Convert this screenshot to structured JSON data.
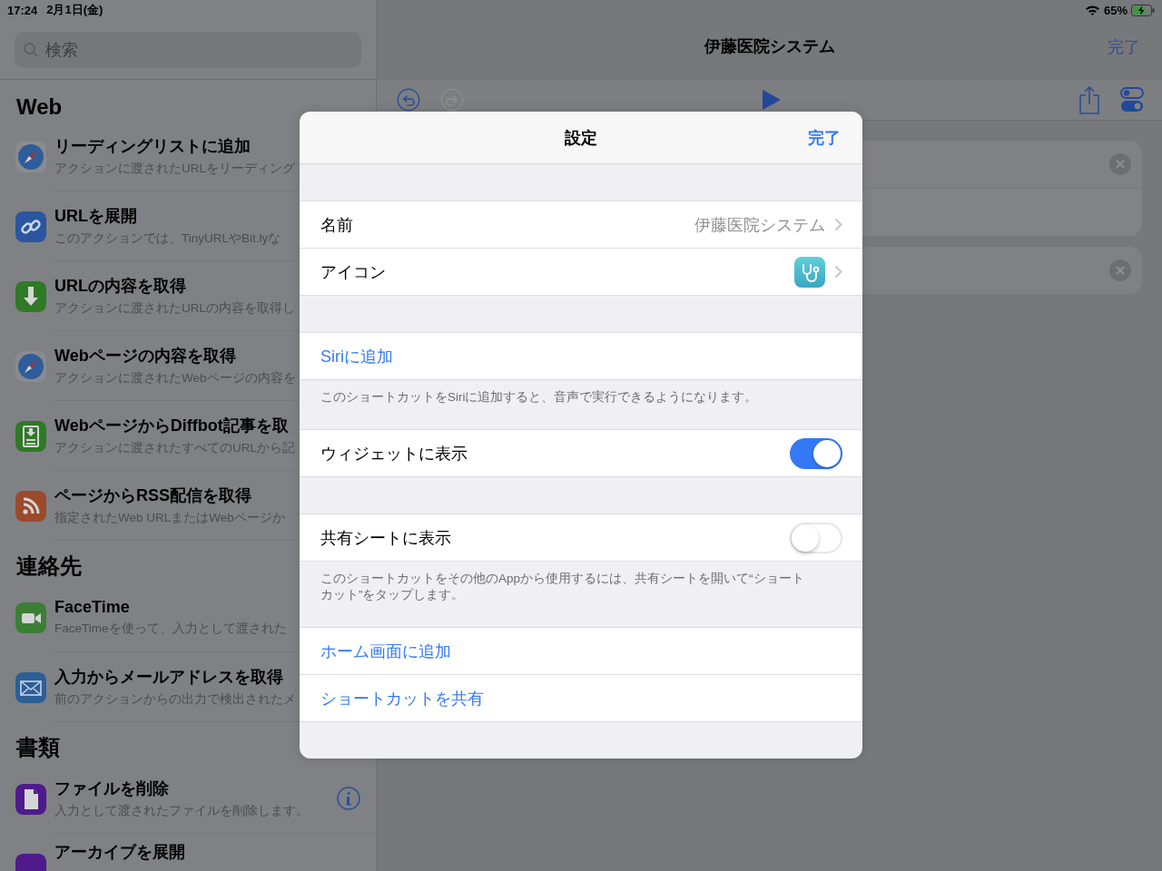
{
  "status_bar": {
    "time": "17:24",
    "date": "2月1日(金)",
    "battery": "65%"
  },
  "sidebar": {
    "search": {
      "placeholder": "検索"
    },
    "sections": [
      {
        "title": "Web",
        "items": [
          {
            "kind": "compass",
            "title": "リーディングリストに追加",
            "subtitle": "アクションに渡されたURLをリーディング",
            "info": false
          },
          {
            "kind": "link",
            "title": "URLを展開",
            "subtitle": "このアクションでは、TinyURLやBit.lyな",
            "info": false
          },
          {
            "kind": "download",
            "title": "URLの内容を取得",
            "subtitle": "アクションに渡されたURLの内容を取得し",
            "info": false
          },
          {
            "kind": "compass",
            "title": "Webページの内容を取得",
            "subtitle": "アクションに渡されたWebページの内容を",
            "info": false
          },
          {
            "kind": "doc-download",
            "title": "WebページからDiffbot記事を取",
            "subtitle": "アクションに渡されたすべてのURLから記",
            "info": false
          },
          {
            "kind": "rss",
            "title": "ページからRSS配信を取得",
            "subtitle": "指定されたWeb URLまたはWebページか",
            "info": false
          }
        ]
      },
      {
        "title": "連絡先",
        "items": [
          {
            "kind": "video",
            "title": "FaceTime",
            "subtitle": "FaceTimeを使って、入力として渡された",
            "info": false
          },
          {
            "kind": "mail",
            "title": "入力からメールアドレスを取得",
            "subtitle": "前のアクションからの出力で検出されたメ",
            "info": false
          }
        ]
      },
      {
        "title": "書類",
        "items": [
          {
            "kind": "file",
            "title": "ファイルを削除",
            "subtitle": "入力として渡されたファイルを削除します。",
            "info": true
          },
          {
            "kind": "archive",
            "title": "アーカイブを展開",
            "info": false
          }
        ]
      }
    ]
  },
  "main": {
    "title": "伊藤医院システム",
    "done": "完了"
  },
  "sheet": {
    "title": "設定",
    "done": "完了",
    "groups": [
      {
        "rows": [
          {
            "kind": "detail",
            "label": "名前",
            "value": "伊藤医院システム"
          },
          {
            "kind": "icon",
            "label": "アイコン"
          }
        ]
      },
      {
        "rows": [
          {
            "kind": "link",
            "label": "Siriに追加"
          }
        ],
        "footer": "このショートカットをSiriに追加すると、音声で実行できるようになります。"
      },
      {
        "rows": [
          {
            "kind": "toggle",
            "label": "ウィジェットに表示",
            "on": true
          }
        ]
      },
      {
        "rows": [
          {
            "kind": "toggle",
            "label": "共有シートに表示",
            "on": false
          }
        ],
        "footer": "このショートカットをその他のAppから使用するには、共有シートを開いて“ショートカット”をタップします。"
      },
      {
        "rows": [
          {
            "kind": "link",
            "label": "ホーム画面に追加"
          },
          {
            "kind": "link",
            "label": "ショートカットを共有"
          }
        ]
      }
    ]
  }
}
